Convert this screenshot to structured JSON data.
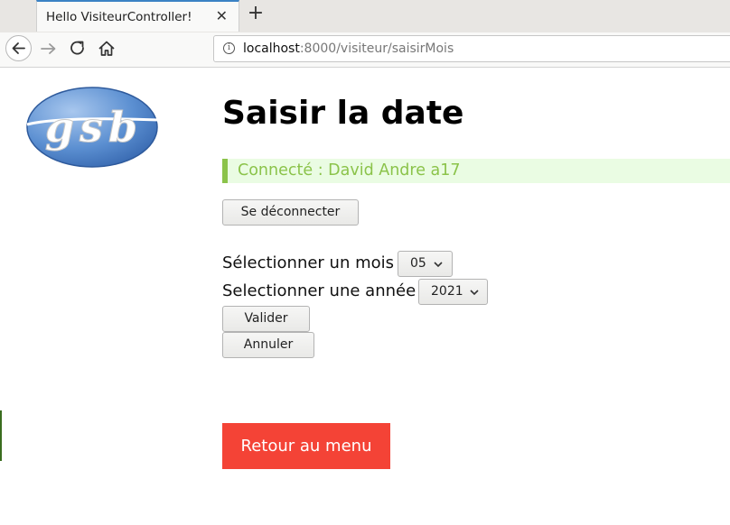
{
  "browser": {
    "tab_title": "Hello VisiteurController!",
    "url_host": "localhost",
    "url_path": ":8000/visiteur/saisirMois"
  },
  "page": {
    "title": "Saisir la date",
    "status": "Connecté : David Andre a17",
    "logout_label": "Se déconnecter",
    "month_label": "Sélectionner un mois",
    "month_value": "05",
    "year_label": "Selectionner une année",
    "year_value": "2021",
    "validate_label": "Valider",
    "cancel_label": "Annuler",
    "back_label": "Retour au menu",
    "logo_text": "gsb"
  },
  "colors": {
    "status_green": "#8bc34a",
    "status_bg": "#eafce3",
    "back_button_red": "#f44336",
    "logo_blue": "#4a7ec4"
  }
}
